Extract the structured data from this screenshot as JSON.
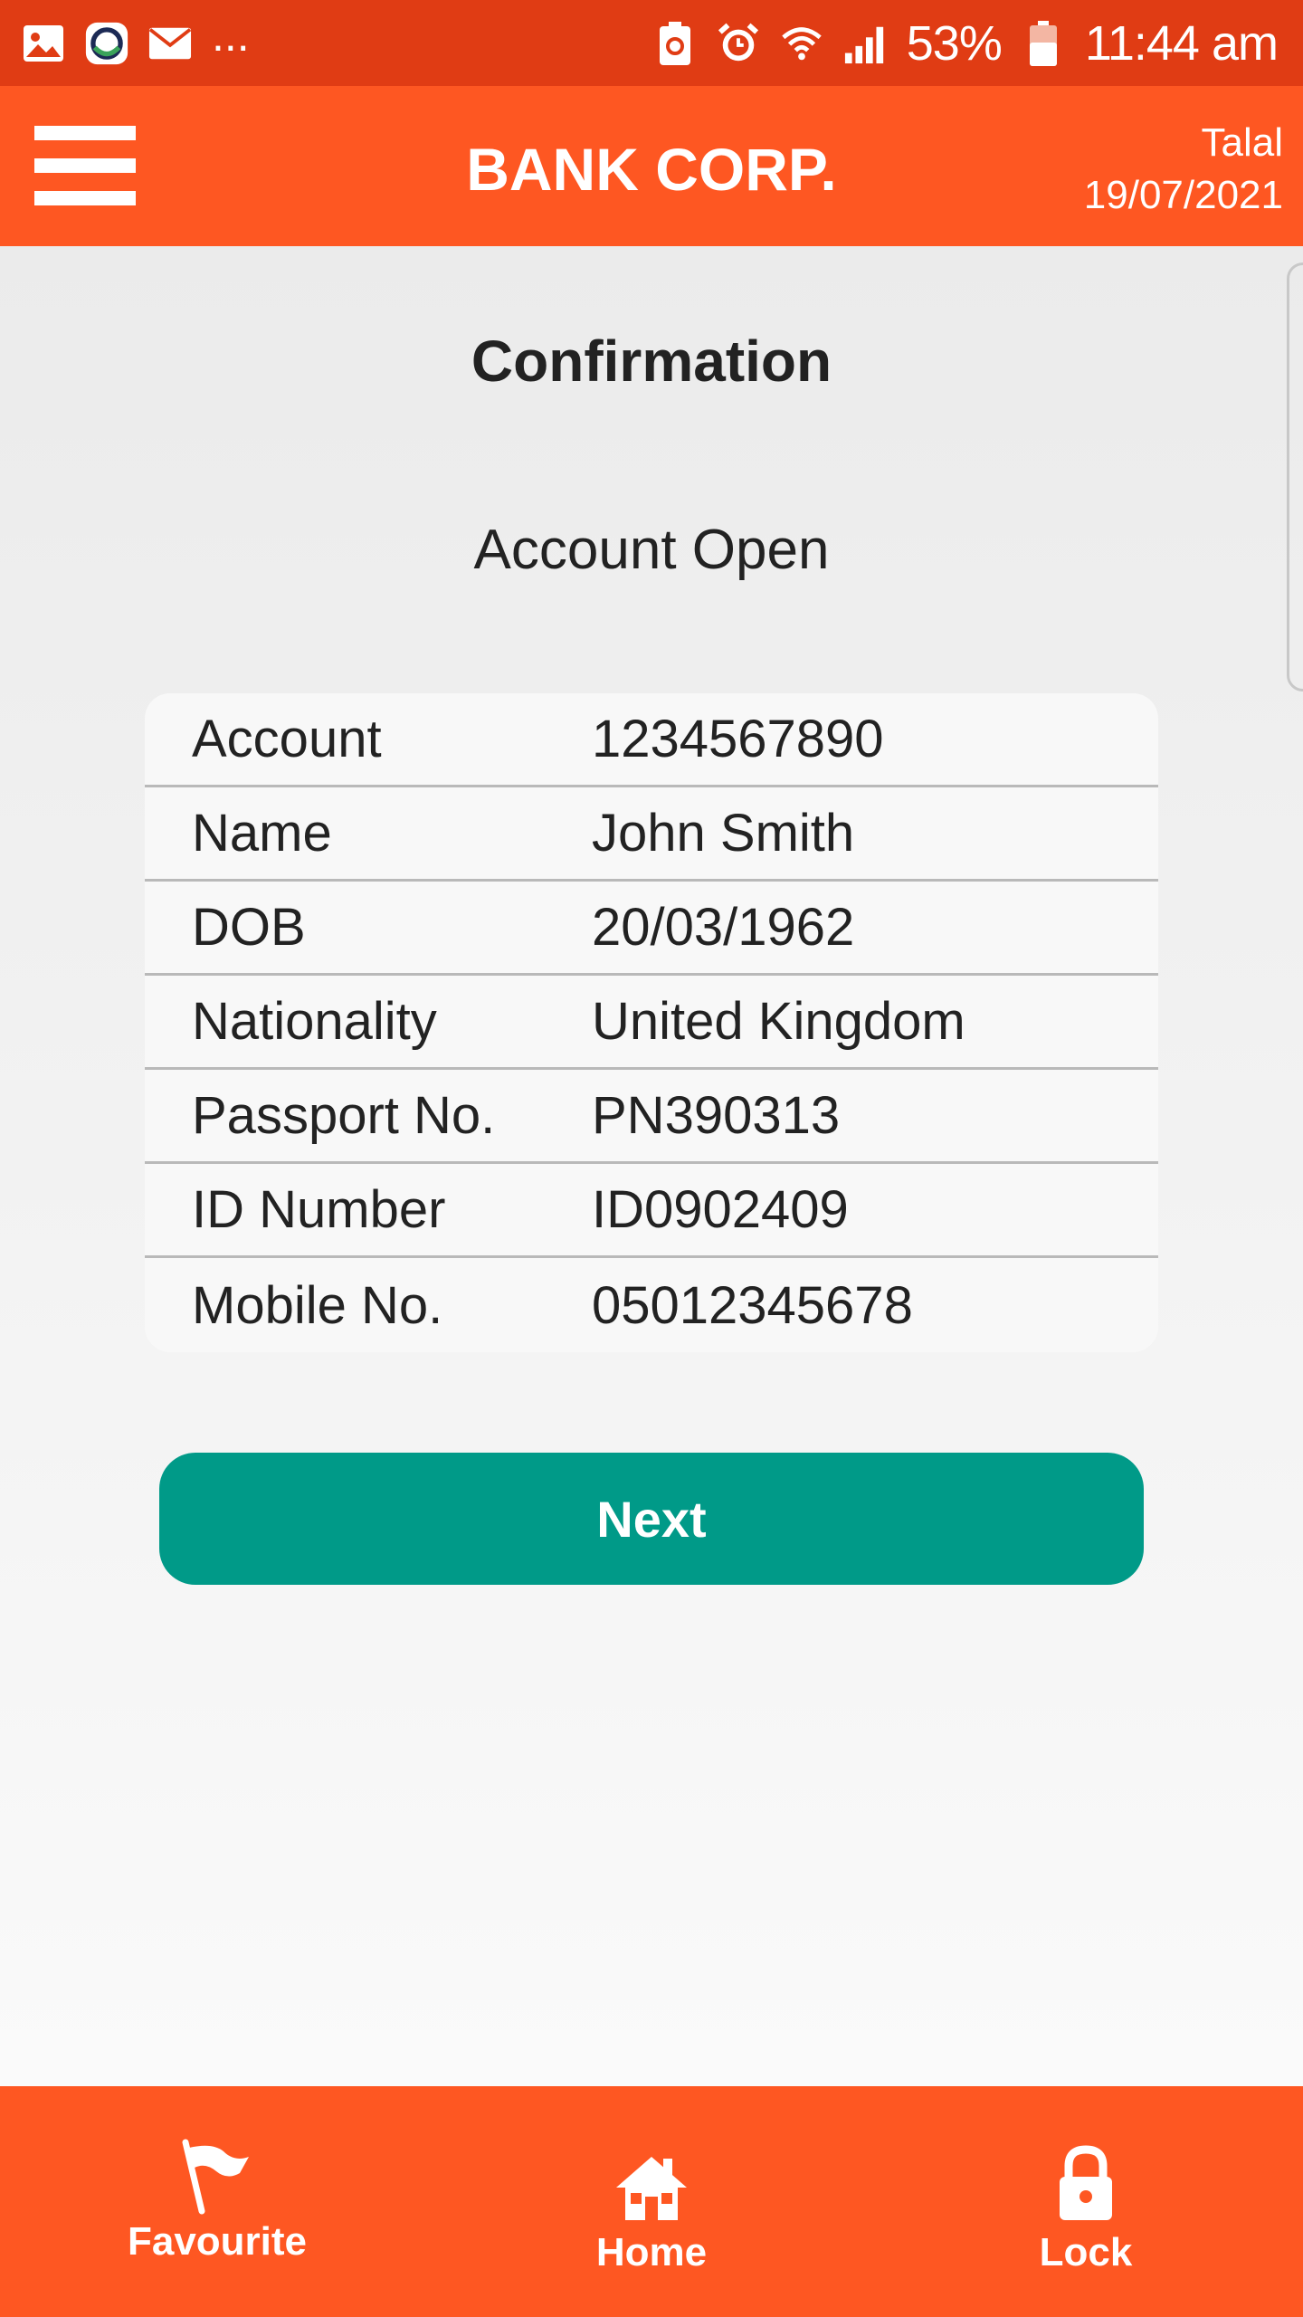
{
  "status_bar": {
    "overflow": "...",
    "battery_percent": "53%",
    "time": "11:44 am"
  },
  "header": {
    "title": "BANK CORP.",
    "user": "Talal",
    "date": "19/07/2021"
  },
  "main": {
    "title": "Confirmation",
    "subtitle": "Account Open",
    "rows": [
      {
        "label": "Account",
        "value": "1234567890"
      },
      {
        "label": "Name",
        "value": "John Smith"
      },
      {
        "label": "DOB",
        "value": "20/03/1962"
      },
      {
        "label": "Nationality",
        "value": "United Kingdom"
      },
      {
        "label": "Passport No.",
        "value": "PN390313"
      },
      {
        "label": "ID Number",
        "value": "ID0902409"
      },
      {
        "label": "Mobile No.",
        "value": "05012345678"
      }
    ],
    "next_label": "Next"
  },
  "bottom_nav": {
    "items": [
      {
        "label": "Favourite",
        "icon": "flag-icon"
      },
      {
        "label": "Home",
        "icon": "home-icon"
      },
      {
        "label": "Lock",
        "icon": "lock-icon"
      }
    ]
  },
  "colors": {
    "status_bar": "#e03c14",
    "header": "#fe5722",
    "button": "#009a88"
  }
}
